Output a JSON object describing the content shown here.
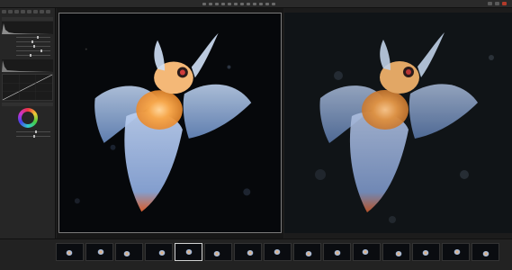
{
  "window": {
    "title": ""
  },
  "topbar": {
    "tools": [
      "tool",
      "tool",
      "tool",
      "tool",
      "tool",
      "tool",
      "tool",
      "tool",
      "tool",
      "tool",
      "tool",
      "tool"
    ],
    "accent": "#b23a2a"
  },
  "left_panel": {
    "tabs": [
      "t1",
      "t2",
      "t3",
      "t4",
      "t5",
      "t6",
      "t7",
      "t8"
    ],
    "sections": [
      {
        "title": "",
        "sliders": [
          {
            "label": "",
            "value": 0.5
          },
          {
            "label": "",
            "value": 0.5
          },
          {
            "label": "",
            "value": 0.5
          },
          {
            "label": "",
            "value": 0.5
          },
          {
            "label": "",
            "value": 0.5
          }
        ]
      },
      {
        "title": "",
        "sliders": [
          {
            "label": "",
            "value": 0.5
          },
          {
            "label": "",
            "value": 0.5
          }
        ]
      }
    ],
    "color_wheel_icon": "color-wheel-icon"
  },
  "viewer_left": {
    "header": "",
    "footer": ""
  },
  "viewer_right": {
    "header": "",
    "footer": ""
  },
  "filmstrip": {
    "thumbnails": [
      {
        "caption": ""
      },
      {
        "caption": ""
      },
      {
        "caption": ""
      },
      {
        "caption": ""
      },
      {
        "caption": ""
      },
      {
        "caption": ""
      },
      {
        "caption": ""
      },
      {
        "caption": ""
      },
      {
        "caption": ""
      },
      {
        "caption": ""
      },
      {
        "caption": ""
      },
      {
        "caption": ""
      },
      {
        "caption": ""
      },
      {
        "caption": ""
      },
      {
        "caption": ""
      }
    ],
    "selected_index": 4
  },
  "colors": {
    "background": "#1e1e1e",
    "panel": "#262626",
    "selection": "#d0d0d0"
  }
}
